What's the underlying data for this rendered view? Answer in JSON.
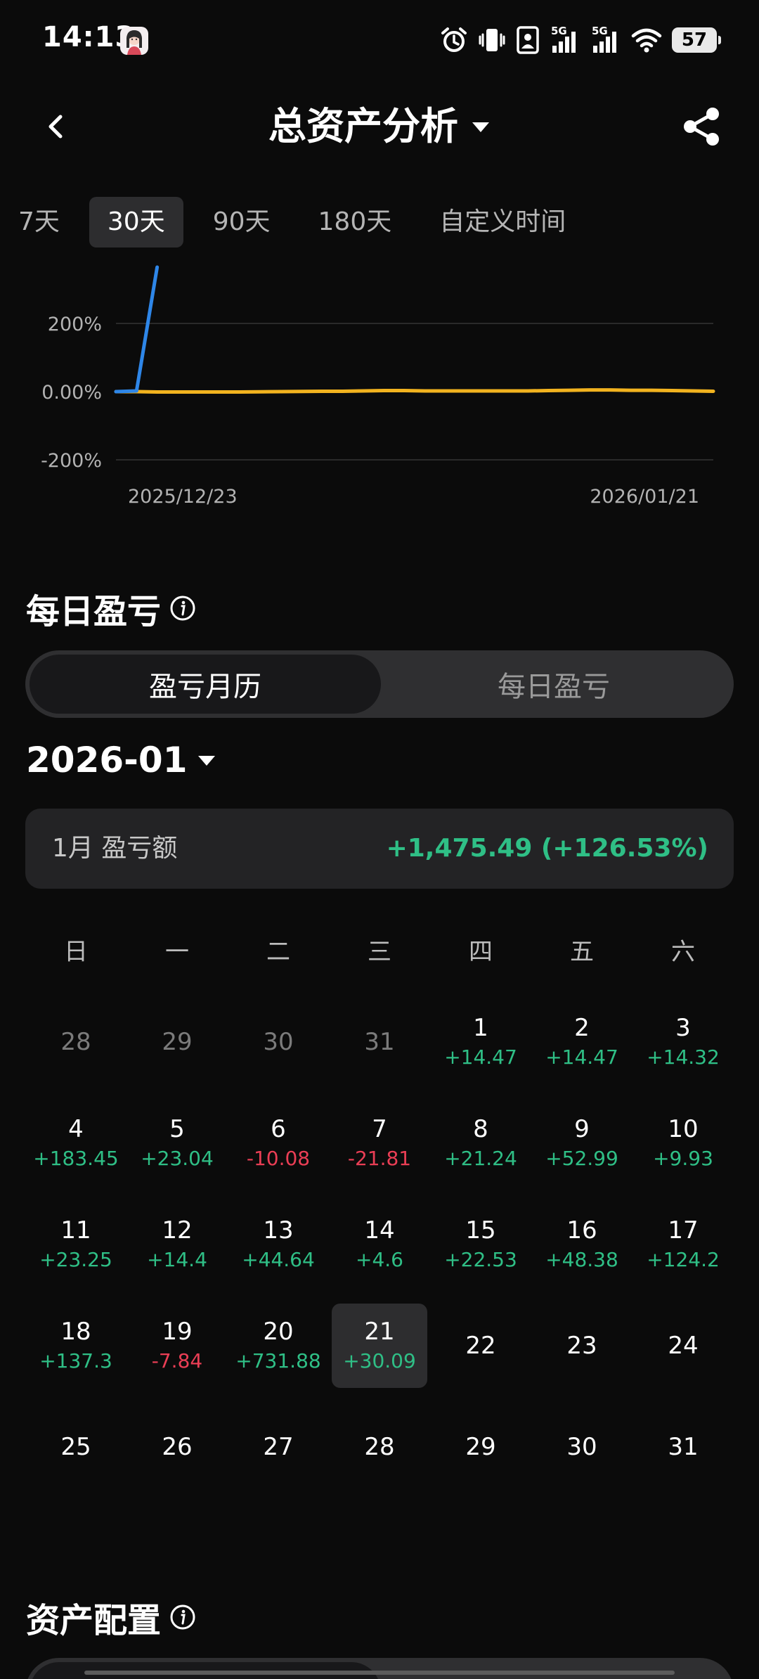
{
  "status_bar": {
    "time": "14:13",
    "battery": "57",
    "signal_tag_1": "5G",
    "signal_tag_2": "5G",
    "icons": [
      "alarm-icon",
      "vibrate-icon",
      "sim-card-icon",
      "signal-icon",
      "signal-icon",
      "wifi-icon",
      "battery-icon"
    ]
  },
  "header": {
    "title": "总资产分析",
    "icons": [
      "back-icon",
      "dropdown-caret-icon",
      "share-icon"
    ]
  },
  "range_tabs": [
    {
      "label": "7天",
      "active": false
    },
    {
      "label": "30天",
      "active": true
    },
    {
      "label": "90天",
      "active": false
    },
    {
      "label": "180天",
      "active": false
    },
    {
      "label": "自定义时间",
      "active": false
    }
  ],
  "chart_data": {
    "type": "line",
    "y_tick_labels": [
      "200%",
      "0.00%",
      "-200%"
    ],
    "x_tick_labels": [
      "2025/12/23",
      "2026/01/21"
    ],
    "ylim": [
      -200,
      200
    ],
    "grid": true,
    "series": [
      {
        "color": "#2e86e8",
        "x": [
          "2025/12/23",
          "2025/12/24",
          "2025/12/25"
        ],
        "values": [
          0,
          2,
          375
        ]
      },
      {
        "color": "#f2b31f",
        "x": [
          "2025/12/23",
          "2025/12/24",
          "2025/12/25",
          "2025/12/26",
          "2025/12/27",
          "2025/12/28",
          "2025/12/29",
          "2025/12/30",
          "2025/12/31",
          "2026/01/01",
          "2026/01/02",
          "2026/01/03",
          "2026/01/04",
          "2026/01/05",
          "2026/01/06",
          "2026/01/07",
          "2026/01/08",
          "2026/01/09",
          "2026/01/10",
          "2026/01/11",
          "2026/01/12",
          "2026/01/13",
          "2026/01/14",
          "2026/01/15",
          "2026/01/16",
          "2026/01/17",
          "2026/01/18",
          "2026/01/19",
          "2026/01/20",
          "2026/01/21"
        ],
        "values": [
          0,
          0,
          -1,
          -1,
          -1,
          -1,
          -1,
          -0.5,
          0,
          0.5,
          1,
          1,
          2,
          3,
          3,
          2,
          2,
          2,
          2,
          2,
          2,
          3,
          4,
          5,
          5,
          4,
          4,
          3,
          2,
          1
        ]
      }
    ]
  },
  "daily_pnl": {
    "title": "每日盈亏",
    "info_icon": "info-icon",
    "segments": [
      {
        "label": "盈亏月历",
        "active": true
      },
      {
        "label": "每日盈亏",
        "active": false
      }
    ],
    "month": "2026-01",
    "summary_label": "1月 盈亏额",
    "summary_value": "+1,475.49 (+126.53%)",
    "weekdays": [
      "日",
      "一",
      "二",
      "三",
      "四",
      "五",
      "六"
    ],
    "colors": {
      "positive": "#2fbf86",
      "negative": "#ea3e55"
    },
    "days": [
      {
        "day": "28",
        "pnl": "",
        "other_month": true
      },
      {
        "day": "29",
        "pnl": "",
        "other_month": true
      },
      {
        "day": "30",
        "pnl": "",
        "other_month": true
      },
      {
        "day": "31",
        "pnl": "",
        "other_month": true
      },
      {
        "day": "1",
        "pnl": "+14.47"
      },
      {
        "day": "2",
        "pnl": "+14.47"
      },
      {
        "day": "3",
        "pnl": "+14.32"
      },
      {
        "day": "4",
        "pnl": "+183.45"
      },
      {
        "day": "5",
        "pnl": "+23.04"
      },
      {
        "day": "6",
        "pnl": "-10.08"
      },
      {
        "day": "7",
        "pnl": "-21.81"
      },
      {
        "day": "8",
        "pnl": "+21.24"
      },
      {
        "day": "9",
        "pnl": "+52.99"
      },
      {
        "day": "10",
        "pnl": "+9.93"
      },
      {
        "day": "11",
        "pnl": "+23.25"
      },
      {
        "day": "12",
        "pnl": "+14.4"
      },
      {
        "day": "13",
        "pnl": "+44.64"
      },
      {
        "day": "14",
        "pnl": "+4.6"
      },
      {
        "day": "15",
        "pnl": "+22.53"
      },
      {
        "day": "16",
        "pnl": "+48.38"
      },
      {
        "day": "17",
        "pnl": "+124.2"
      },
      {
        "day": "18",
        "pnl": "+137.3"
      },
      {
        "day": "19",
        "pnl": "-7.84"
      },
      {
        "day": "20",
        "pnl": "+731.88"
      },
      {
        "day": "21",
        "pnl": "+30.09",
        "today": true
      },
      {
        "day": "22",
        "pnl": ""
      },
      {
        "day": "23",
        "pnl": ""
      },
      {
        "day": "24",
        "pnl": ""
      },
      {
        "day": "25",
        "pnl": ""
      },
      {
        "day": "26",
        "pnl": ""
      },
      {
        "day": "27",
        "pnl": ""
      },
      {
        "day": "28",
        "pnl": ""
      },
      {
        "day": "29",
        "pnl": ""
      },
      {
        "day": "30",
        "pnl": ""
      },
      {
        "day": "31",
        "pnl": ""
      }
    ]
  },
  "asset_allocation": {
    "title": "资产配置",
    "info_icon": "info-icon"
  }
}
